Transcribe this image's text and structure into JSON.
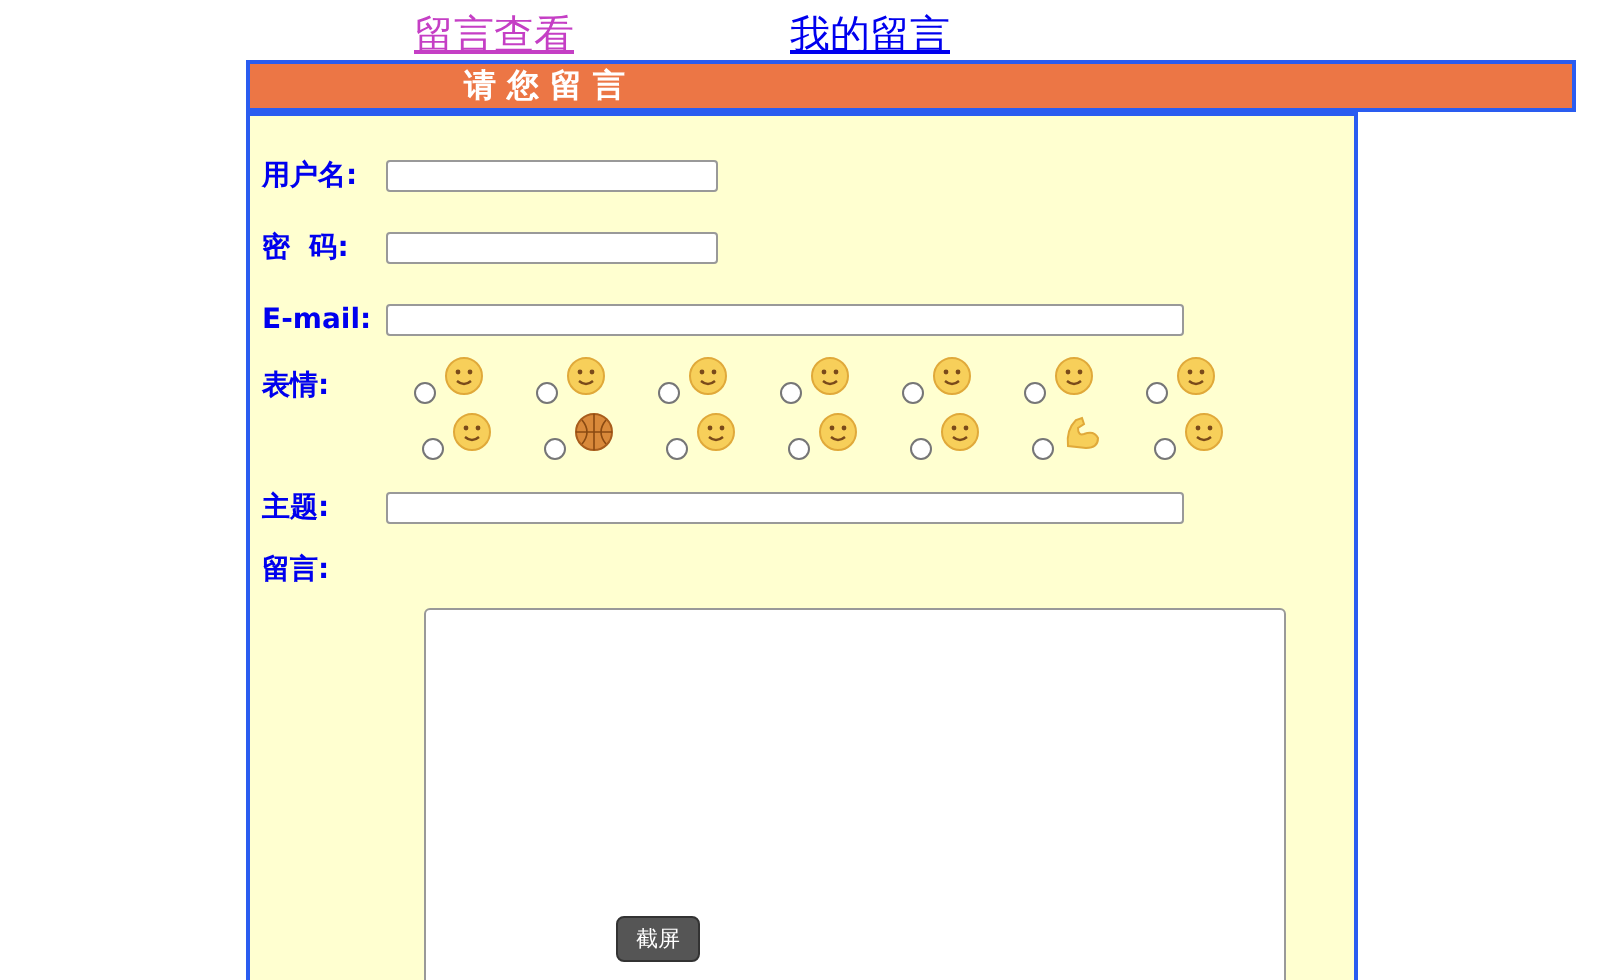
{
  "nav_links": [
    {
      "label": "留言查看",
      "visited": true
    },
    {
      "label": "我的留言",
      "visited": false
    }
  ],
  "header": {
    "title": "请 您 留 言"
  },
  "form": {
    "fields": [
      {
        "label": "用户名:",
        "kind": "short"
      },
      {
        "label": "密  码:",
        "kind": "short"
      },
      {
        "label": "E-mail:",
        "kind": "long"
      }
    ],
    "emotion_label": "表情:",
    "emotions": [
      {
        "kind": "face",
        "selected": false
      },
      {
        "kind": "face",
        "selected": false
      },
      {
        "kind": "face",
        "selected": false
      },
      {
        "kind": "face",
        "selected": false
      },
      {
        "kind": "face",
        "selected": false
      },
      {
        "kind": "face",
        "selected": false
      },
      {
        "kind": "face",
        "selected": false
      },
      {
        "kind": "face",
        "selected": false
      },
      {
        "kind": "ball",
        "selected": false
      },
      {
        "kind": "face",
        "selected": false
      },
      {
        "kind": "face",
        "selected": false
      },
      {
        "kind": "face",
        "selected": false
      },
      {
        "kind": "arm",
        "selected": false
      },
      {
        "kind": "face",
        "selected": false
      }
    ],
    "subject_label": "主题:",
    "message_label": "留言:"
  },
  "tooltip": {
    "text": "截屏"
  }
}
